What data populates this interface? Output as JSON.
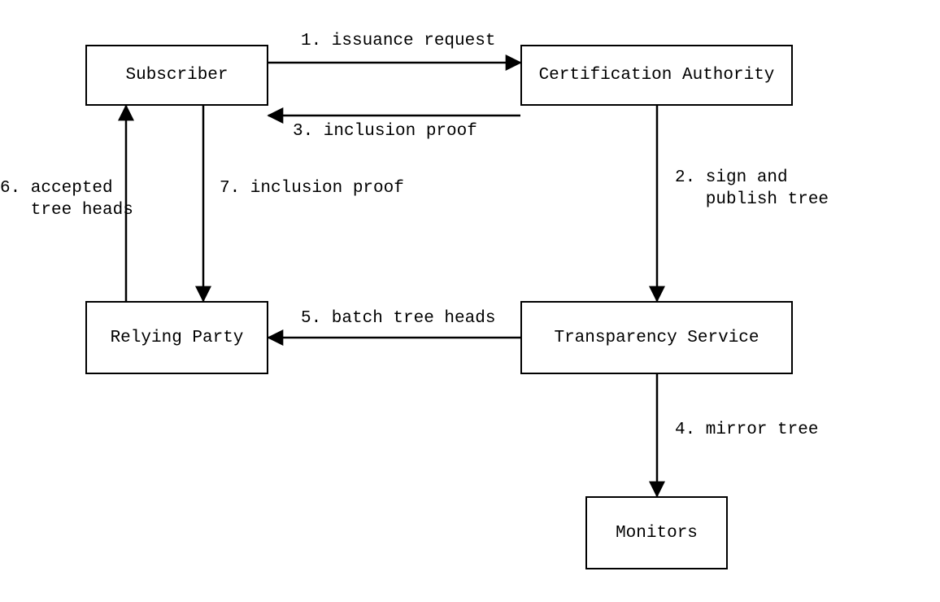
{
  "nodes": {
    "subscriber": "Subscriber",
    "ca": "Certification Authority",
    "relying_party": "Relying Party",
    "transparency_service": "Transparency Service",
    "monitors": "Monitors"
  },
  "edges": {
    "e1": "1. issuance request",
    "e2_l1": "2. sign and",
    "e2_l2": "   publish tree",
    "e3": "3. inclusion proof",
    "e4": "4. mirror tree",
    "e5": "5. batch tree heads",
    "e6_l1": "6. accepted",
    "e6_l2": "   tree heads",
    "e7": "7. inclusion proof"
  }
}
